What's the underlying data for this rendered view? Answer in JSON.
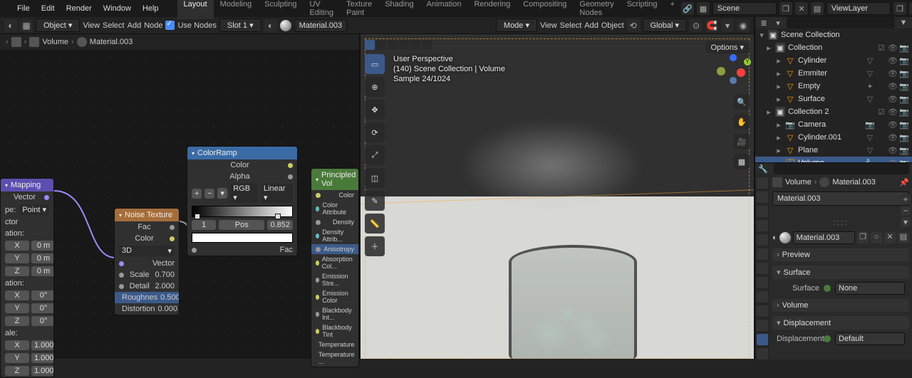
{
  "topbar": {
    "menus": [
      "File",
      "Edit",
      "Render",
      "Window",
      "Help"
    ],
    "workspaces": [
      "Layout",
      "Modeling",
      "Sculpting",
      "UV Editing",
      "Texture Paint",
      "Shading",
      "Animation",
      "Rendering",
      "Compositing",
      "Geometry Nodes",
      "Scripting"
    ],
    "active_workspace": 0,
    "scene_label": "Scene",
    "layer_label": "ViewLayer"
  },
  "node_header": {
    "mode": "Object",
    "menus": [
      "View",
      "Select",
      "Add",
      "Node"
    ],
    "use_nodes_label": "Use Nodes",
    "use_nodes_checked": true,
    "slot": "Slot 1",
    "material": "Material.003"
  },
  "viewport_header": {
    "mode": "Mode",
    "menus": [
      "View",
      "Select",
      "Add",
      "Object"
    ],
    "orientation": "Global"
  },
  "breadcrumb": {
    "world": "",
    "object": "Volume",
    "material": "Material.003"
  },
  "viewport_overlay": {
    "line1": "User Perspective",
    "line2": "(140) Scene Collection | Volume",
    "line3": "Sample 24/1024",
    "options_label": "Options"
  },
  "nodes": {
    "mapping": {
      "title": "Mapping",
      "vector_out": "Vector",
      "type_label": "pe:",
      "type_value": "Point",
      "loc_label": "ation:",
      "rot_label": "ation:",
      "scale_label": "ale:",
      "vector_in": "ctor",
      "axes": [
        "X",
        "Y",
        "Z"
      ],
      "loc_values": [
        "0 m",
        "0 m",
        "0 m"
      ],
      "rot_values": [
        "0°",
        "0°",
        "0°"
      ],
      "scale_values": [
        "1.000",
        "1.000",
        "1.000"
      ]
    },
    "noise": {
      "title": "Noise Texture",
      "fac_out": "Fac",
      "color_out": "Color",
      "dims": "3D",
      "vector_in": "Vector",
      "props": [
        {
          "label": "Scale",
          "value": "0.700",
          "sel": false
        },
        {
          "label": "Detail",
          "value": "2.000",
          "sel": false
        },
        {
          "label": "Roughnes",
          "value": "0.500",
          "sel": true
        },
        {
          "label": "Distortion",
          "value": "0.000",
          "sel": false
        }
      ]
    },
    "colorramp": {
      "title": "ColorRamp",
      "color_out": "Color",
      "alpha_out": "Alpha",
      "interp1": "RGB",
      "interp2": "Linear",
      "index": "1",
      "pos_label": "Pos",
      "pos_value": "0.852",
      "fac_in": "Fac"
    },
    "principled": {
      "title": "Principled Vol",
      "sockets": [
        {
          "label": "Color",
          "sel": false,
          "dot": "yellow"
        },
        {
          "label": "Color Attribute",
          "sel": false,
          "dot": "teal"
        },
        {
          "label": "Density",
          "sel": false,
          "dot": "grey"
        },
        {
          "label": "Density Attrib...",
          "sel": false,
          "dot": "teal"
        },
        {
          "label": "Anisotropy",
          "sel": true,
          "dot": "grey"
        },
        {
          "label": "Absorption Col...",
          "sel": false,
          "dot": "yellow"
        },
        {
          "label": "Emission Stre...",
          "sel": false,
          "dot": "grey"
        },
        {
          "label": "Emission Color",
          "sel": false,
          "dot": "yellow"
        },
        {
          "label": "Blackbody Int...",
          "sel": false,
          "dot": "grey"
        },
        {
          "label": "Blackbody Tint",
          "sel": false,
          "dot": "yellow"
        },
        {
          "label": "Temperature",
          "sel": false,
          "dot": "grey"
        },
        {
          "label": "Temperature ...",
          "sel": false,
          "dot": "teal"
        }
      ]
    }
  },
  "outliner": {
    "root": "Scene Collection",
    "items": [
      {
        "level": 1,
        "icon": "box",
        "label": "Collection",
        "trail": [
          "check",
          "eye",
          "cam"
        ]
      },
      {
        "level": 2,
        "icon": "orange",
        "label": "Cylinder",
        "trail": [
          "tri",
          "",
          "eye",
          "cam"
        ]
      },
      {
        "level": 2,
        "icon": "orange",
        "label": "Emmiter",
        "trail": [
          "tri",
          "",
          "eye",
          "cam"
        ]
      },
      {
        "level": 2,
        "icon": "orange",
        "label": "Empty",
        "trail": [
          "axis",
          "",
          "eye",
          "cam"
        ]
      },
      {
        "level": 2,
        "icon": "orange",
        "label": "Surface",
        "trail": [
          "tri",
          "",
          "eye",
          "cam"
        ]
      },
      {
        "level": 1,
        "icon": "box",
        "label": "Collection 2",
        "trail": [
          "check",
          "eye",
          "cam"
        ]
      },
      {
        "level": 2,
        "icon": "cam",
        "label": "Camera",
        "trail": [
          "cam",
          "",
          "eye",
          "cam"
        ]
      },
      {
        "level": 2,
        "icon": "orange",
        "label": "Cylinder.001",
        "trail": [
          "tri",
          "",
          "eye",
          "cam"
        ]
      },
      {
        "level": 2,
        "icon": "orange",
        "label": "Plane",
        "trail": [
          "tri",
          "",
          "eye",
          "cam"
        ]
      },
      {
        "level": 2,
        "icon": "vol",
        "label": "Volume",
        "trail": [
          "mod",
          "",
          "eye",
          "cam"
        ],
        "sel": true
      }
    ]
  },
  "properties": {
    "crumb_obj": "Volume",
    "crumb_mat": "Material.003",
    "slot_name": "Material.003",
    "mat_name": "Material.003",
    "sections": {
      "preview": "Preview",
      "surface": "Surface",
      "volume": "Volume",
      "displacement": "Displacement"
    },
    "surface_field_label": "Surface",
    "surface_field_value": "None",
    "disp_field_label": "Displacement",
    "disp_field_value": "Default"
  }
}
